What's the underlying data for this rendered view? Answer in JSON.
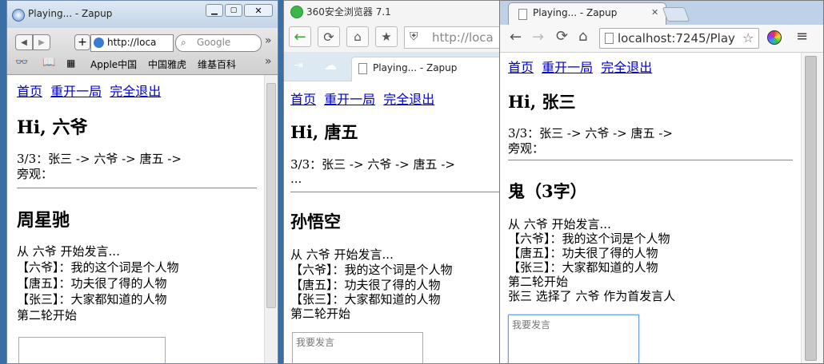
{
  "window1": {
    "tab_title": "Playing... - Zapup",
    "url": "http://loca",
    "search_placeholder": "Google",
    "bookmarks": [
      "Apple中国",
      "中国雅虎",
      "维基百科"
    ],
    "page": {
      "nav": [
        "首页",
        "重开一局",
        "完全退出"
      ],
      "greeting": "Hi, 六爷",
      "order": "3/3：张三 -> 六爷 -> 唐五 ->",
      "observers": "旁观：",
      "word": "周星驰",
      "log": [
        "从 六爷 开始发言...",
        "【六爷】：我的这个词是个人物",
        "【唐五】：功夫很了得的人物",
        "【张三】：大家都知道的人物",
        "第二轮开始"
      ],
      "input_placeholder": ""
    }
  },
  "window2": {
    "app_title": "360安全浏览器 7.1",
    "url": "http://loca",
    "tab_title": "Playing... - Zapup",
    "page": {
      "nav": [
        "首页",
        "重开一局",
        "完全退出"
      ],
      "greeting": "Hi, 唐五",
      "order": "3/3：张三 -> 六爷 -> 唐五 ->",
      "observers": "...",
      "word": "孙悟空",
      "log": [
        "从 六爷 开始发言...",
        "【六爷】：我的这个词是个人物",
        "【唐五】：功夫很了得的人物",
        "【张三】：大家都知道的人物",
        "第二轮开始"
      ],
      "input_placeholder": "我要发言"
    }
  },
  "window3": {
    "tab_title": "Playing... - Zapup",
    "url": "localhost:7245/Play",
    "page": {
      "nav": [
        "首页",
        "重开一局",
        "完全退出"
      ],
      "greeting": "Hi, 张三",
      "order": "3/3：张三 -> 六爷 -> 唐五 ->",
      "observers": "旁观：",
      "word": "鬼（3字）",
      "log": [
        "从 六爷 开始发言...",
        "【六爷】：我的这个词是个人物",
        "【唐五】：功夫很了得的人物",
        "【张三】：大家都知道的人物",
        "第二轮开始",
        "张三 选择了 六爷 作为首发言人"
      ],
      "input_placeholder": "我要发言"
    }
  }
}
